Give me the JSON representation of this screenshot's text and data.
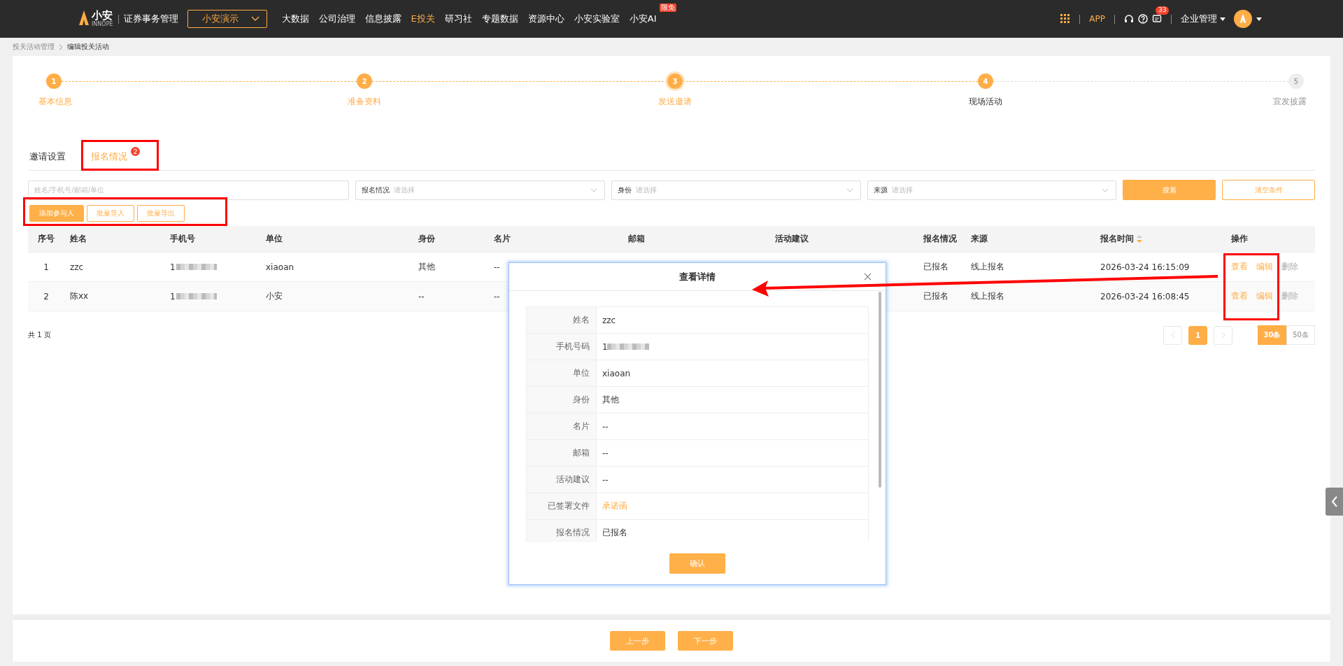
{
  "header": {
    "logo": "小安",
    "logo_sub": "INNOPE",
    "product": "证券事务管理",
    "org_select": "小安演示",
    "nav": [
      {
        "label": "大数据",
        "selected": false
      },
      {
        "label": "公司治理",
        "selected": false
      },
      {
        "label": "信息披露",
        "selected": false
      },
      {
        "label": "E投关",
        "selected": true
      },
      {
        "label": "研习社",
        "selected": false
      },
      {
        "label": "专题数据",
        "selected": false
      },
      {
        "label": "资源中心",
        "selected": false
      },
      {
        "label": "小安实验室",
        "selected": false
      },
      {
        "label": "小安AI",
        "selected": false,
        "badge": "限免"
      }
    ],
    "app": "APP",
    "message_count": "33",
    "enterprise": "企业管理"
  },
  "breadcrumb": [
    "投关活动管理",
    "编辑投关活动"
  ],
  "steps": [
    {
      "number": "1",
      "label": "基本信息",
      "enabled": true,
      "done": true,
      "current": false
    },
    {
      "number": "2",
      "label": "准备资料",
      "enabled": true,
      "done": true,
      "current": false
    },
    {
      "number": "3",
      "label": "发送邀请",
      "enabled": true,
      "done": true,
      "current": true
    },
    {
      "number": "4",
      "label": "现场活动",
      "enabled": true,
      "done": false,
      "current": false
    },
    {
      "number": "5",
      "label": "宣发披露",
      "enabled": false,
      "done": false,
      "current": false
    }
  ],
  "tabs": [
    {
      "label": "邀请设置",
      "selected": false
    },
    {
      "label": "报名情况",
      "selected": true,
      "badge": "2"
    }
  ],
  "filters": {
    "keyword_placeholder": "姓名/手机号/邮箱/单位",
    "selects": [
      {
        "label": "报名情况",
        "placeholder": "请选择"
      },
      {
        "label": "身份",
        "placeholder": "请选择"
      },
      {
        "label": "来源",
        "placeholder": "请选择"
      }
    ],
    "search": "搜索",
    "clear": "清空条件"
  },
  "actions": [
    {
      "label": "添加参与人",
      "primary": true
    },
    {
      "label": "批量导入",
      "primary": false
    },
    {
      "label": "批量导出",
      "primary": false
    }
  ],
  "table": {
    "columns": [
      "序号",
      "姓名",
      "手机号",
      "单位",
      "身份",
      "名片",
      "邮箱",
      "活动建议",
      "报名情况",
      "来源",
      "报名时间",
      "操作"
    ],
    "rows": [
      {
        "index": "1",
        "name": "zzc",
        "phone": "1",
        "org": "xiaoan",
        "identity": "其他",
        "card": "--",
        "status": "已报名",
        "source": "线上报名",
        "time": "2026-03-24 16:15:09",
        "ops": [
          {
            "label": "查看",
            "disabled": false
          },
          {
            "label": "编辑",
            "disabled": false
          },
          {
            "label": "删除",
            "disabled": true
          }
        ]
      },
      {
        "index": "2",
        "name": "陈xx",
        "phone": "1",
        "org": "小安",
        "identity": "--",
        "card": "--",
        "status": "已报名",
        "source": "线上报名",
        "time": "2026-03-24 16:08:45",
        "ops": [
          {
            "label": "查看",
            "disabled": false
          },
          {
            "label": "编辑",
            "disabled": false
          },
          {
            "label": "删除",
            "disabled": true
          }
        ]
      }
    ]
  },
  "pager": {
    "total": "共 1 页",
    "pages": [
      {
        "label": "1",
        "selected": true
      }
    ],
    "sizes": [
      {
        "label": "30条",
        "selected": true
      },
      {
        "label": "50条",
        "selected": false
      }
    ]
  },
  "modal": {
    "title": "查看详情",
    "fields": [
      {
        "label": "姓名",
        "value": "zzc",
        "kind": "text"
      },
      {
        "label": "手机号码",
        "value": "1",
        "kind": "blurred"
      },
      {
        "label": "单位",
        "value": "xiaoan",
        "kind": "text"
      },
      {
        "label": "身份",
        "value": "其他",
        "kind": "text"
      },
      {
        "label": "名片",
        "value": "--",
        "kind": "text"
      },
      {
        "label": "邮箱",
        "value": "--",
        "kind": "text"
      },
      {
        "label": "活动建议",
        "value": "--",
        "kind": "text"
      },
      {
        "label": "已签署文件",
        "value": "承诺函",
        "kind": "link"
      },
      {
        "label": "报名情况",
        "value": "已报名",
        "kind": "text"
      }
    ],
    "confirm": "确认"
  },
  "footer": {
    "prev": "上一步",
    "next": "下一步"
  }
}
